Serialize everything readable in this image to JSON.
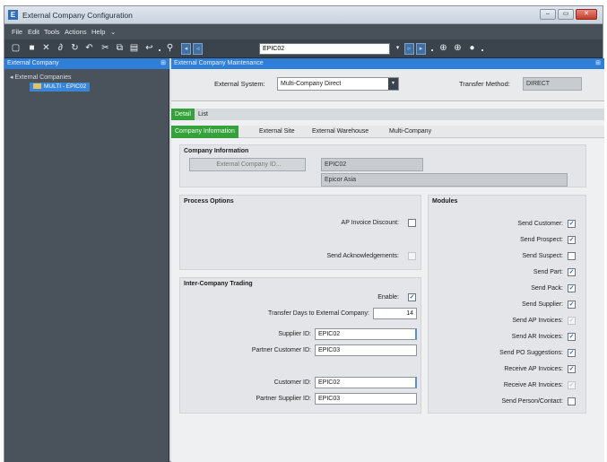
{
  "window": {
    "title": "External Company Configuration",
    "icon_letter": "E",
    "controls": [
      "–",
      "▭",
      "✕"
    ]
  },
  "menu": [
    "File",
    "Edit",
    "Tools",
    "Actions",
    "Help",
    "⌄"
  ],
  "toolbar": {
    "search_value": "EPIC02",
    "icons": [
      "new-icon",
      "save-icon",
      "delete-icon",
      "attach-icon",
      "refresh-icon",
      "undo-icon",
      "cut-icon",
      "copy-icon",
      "paste-icon",
      "back-icon",
      "search-icon",
      "nav-prev-icon",
      "nav-next-icon",
      "nav-first-icon",
      "nav-last-icon",
      "circle-1-icon",
      "circle-2-icon",
      "circle-3-icon"
    ]
  },
  "left_panel": {
    "title": "External Company",
    "tree_root": "◂  External Companies",
    "tree_child": "MULTI - EPIC02"
  },
  "right_panel": {
    "title": "External Company Maintenance",
    "external_system_label": "External System:",
    "external_system_value": "Multi-Company Direct",
    "transfer_method_label": "Transfer Method:",
    "transfer_method_value": "DIRECT"
  },
  "tabs_top": [
    "Detail",
    "List"
  ],
  "tabs_sub": [
    "Company Information",
    "External Site",
    "External Warehouse",
    "Multi-Company"
  ],
  "company_info": {
    "title": "Company Information",
    "ext_company_id_btn": "External Company ID...",
    "ext_company_id_value": "EPIC02",
    "company_name": "Epicor Asia"
  },
  "process_options": {
    "title": "Process Options",
    "ap_invoice_discount": "AP Invoice Discount:",
    "send_acknowledgements": "Send Acknowledgements:"
  },
  "intercompany": {
    "title": "Inter-Company Trading",
    "enable_label": "Enable:",
    "transfer_days_label": "Transfer Days to External Company:",
    "transfer_days_value": "14",
    "supplier_id_label": "Supplier ID:",
    "supplier_id_value": "EPIC02",
    "partner_customer_id_label": "Partner Customer ID:",
    "partner_customer_id_value": "EPIC03",
    "customer_id_label": "Customer ID:",
    "customer_id_value": "EPIC02",
    "partner_supplier_id_label": "Partner Supplier ID:",
    "partner_supplier_id_value": "EPIC03"
  },
  "modules": {
    "title": "Modules",
    "items": [
      {
        "label": "Send Customer:",
        "checked": "✓"
      },
      {
        "label": "Send Prospect:",
        "checked": "✓"
      },
      {
        "label": "Send Suspect:",
        "checked": ""
      },
      {
        "label": "Send Part:",
        "checked": "✓"
      },
      {
        "label": "Send Pack:",
        "checked": "✓"
      },
      {
        "label": "Send Supplier:",
        "checked": "✓"
      },
      {
        "label": "Send AP Invoices:",
        "checked": "✓"
      },
      {
        "label": "Send AR Invoices:",
        "checked": "✓"
      },
      {
        "label": "Send PO Suggestions:",
        "checked": "✓"
      },
      {
        "label": "Receive AP Invoices:",
        "checked": "✓"
      },
      {
        "label": "Receive AR Invoices:",
        "checked": "✓"
      },
      {
        "label": "Send Person/Contact:",
        "checked": ""
      }
    ]
  }
}
